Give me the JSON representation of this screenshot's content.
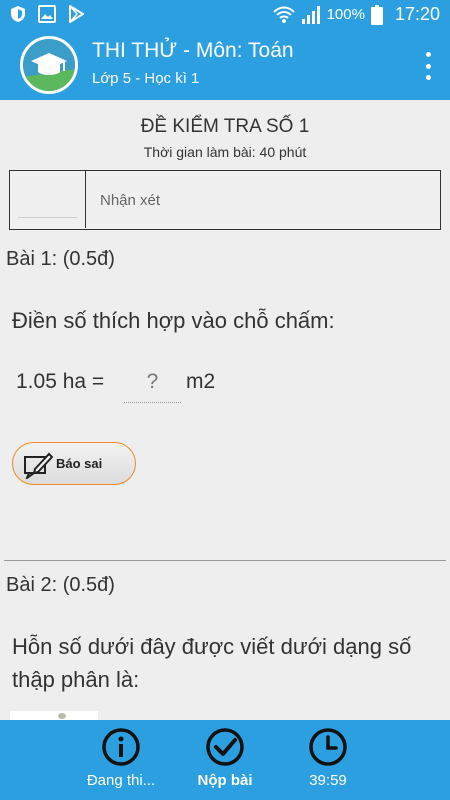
{
  "status_bar": {
    "battery_percent": "100%",
    "time": "17:20"
  },
  "app_bar": {
    "title": "THI THỬ - Môn: Toán",
    "subtitle": "Lớp 5 - Học kì 1"
  },
  "exam": {
    "title": "ĐỀ KIỂM TRA SỐ 1",
    "time_limit": "Thời gian làm bài: 40 phút",
    "comment_label": "Nhận xét"
  },
  "questions": [
    {
      "header": "Bài 1: (0.5đ)",
      "prompt": "Điền số thích hợp vào chỗ chấm:",
      "answer_lhs": "1.05 ha =",
      "answer_blank": "?",
      "answer_unit": "m2",
      "report_label": "Báo sai"
    },
    {
      "header": "Bài 2: (0.5đ)",
      "prompt": "Hỗn số dưới đây được viết dưới dạng số thập phân là:"
    }
  ],
  "bottom_nav": [
    {
      "label": "Đang thi...",
      "icon": "info-icon"
    },
    {
      "label": "Nộp bài",
      "icon": "check-circle-icon"
    },
    {
      "label": "39:59",
      "icon": "clock-icon"
    }
  ],
  "colors": {
    "primary": "#2b9fdf",
    "report_border": "#f08b2a",
    "background": "#eeeeee"
  }
}
